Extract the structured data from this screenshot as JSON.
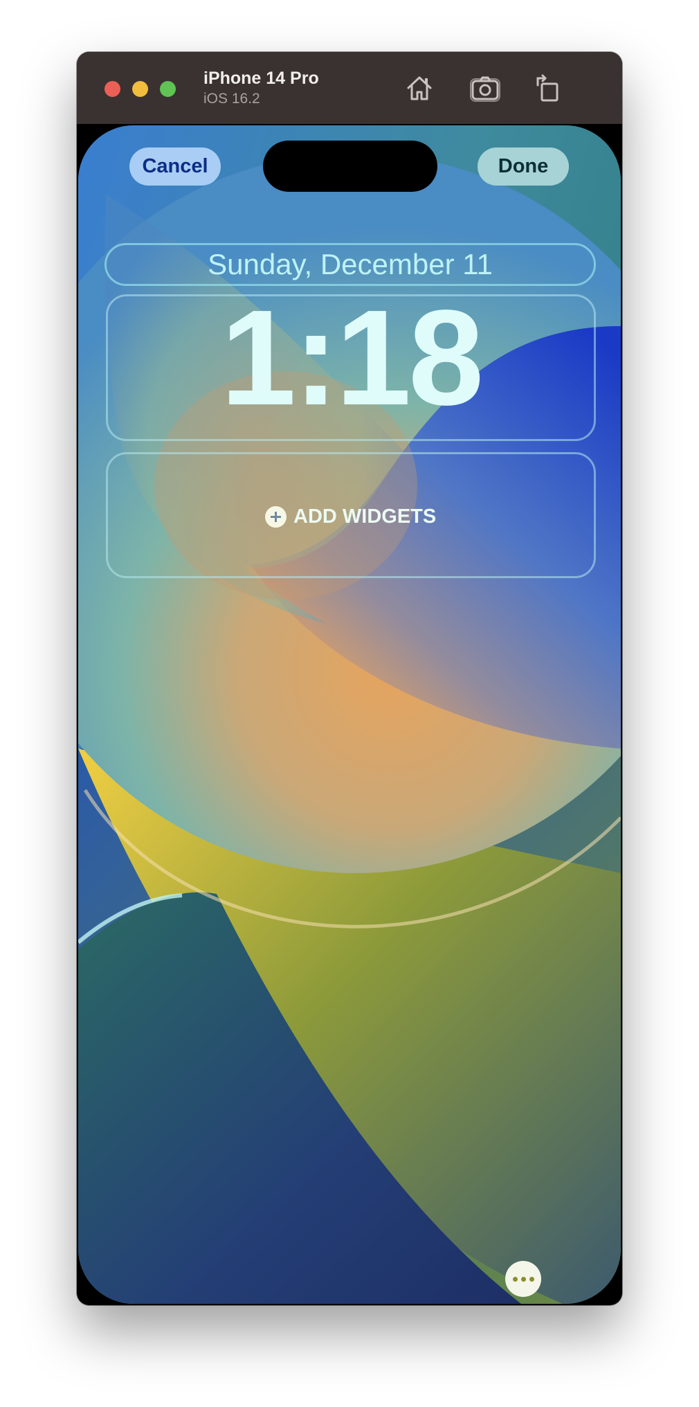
{
  "window": {
    "title": "iPhone 14 Pro",
    "subtitle": "iOS 16.2",
    "toolbar_icons": [
      "home-icon",
      "screenshot-icon",
      "rotate-icon"
    ]
  },
  "lockscreen": {
    "cancel_label": "Cancel",
    "done_label": "Done",
    "date": "Sunday, December 11",
    "time": "1:18",
    "add_widgets_label": "ADD WIDGETS",
    "more_icon": "ellipsis-icon"
  },
  "colors": {
    "titlebar": "#3a3230",
    "cancel_bg": "#a9cdf4",
    "done_bg": "#a7d3d6",
    "date_text": "#bdf3f7"
  }
}
